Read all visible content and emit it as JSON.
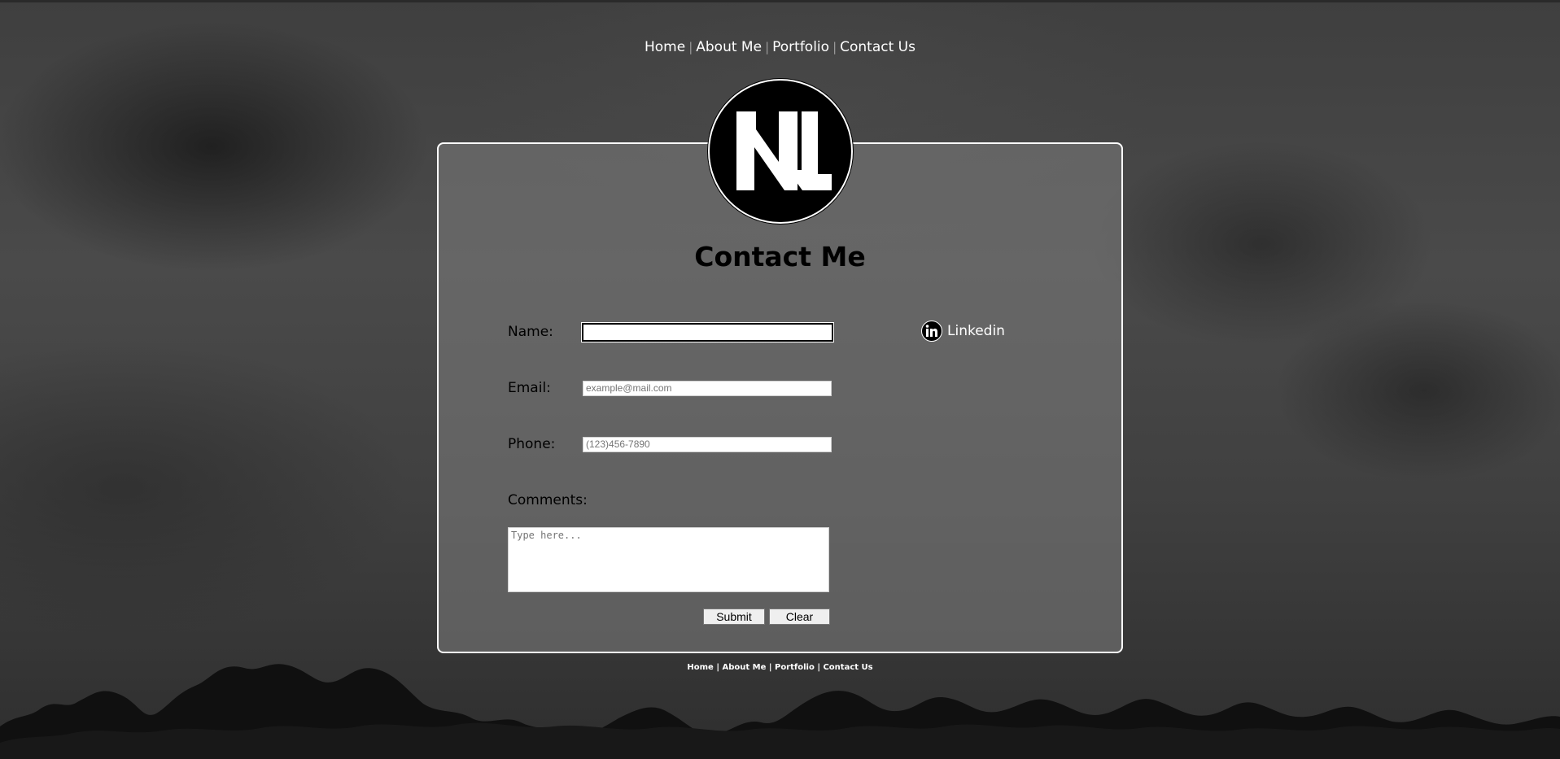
{
  "nav": {
    "items": [
      "Home",
      "About Me",
      "Portfolio",
      "Contact Us"
    ],
    "separator": "|"
  },
  "logo": {
    "text": "NL"
  },
  "page_title": "Contact Me",
  "form": {
    "name_label": "Name:",
    "name_value": "",
    "email_label": "Email:",
    "email_placeholder": "example@mail.com",
    "phone_label": "Phone:",
    "phone_placeholder": "(123)456-7890",
    "comments_label": "Comments:",
    "comments_placeholder": "Type here...",
    "submit_label": "Submit",
    "clear_label": "Clear"
  },
  "social": {
    "linkedin_label": "Linkedin",
    "icon": "linkedin-icon"
  },
  "footer": {
    "items": [
      "Home",
      "About Me",
      "Portfolio",
      "Contact Us"
    ],
    "separator": "|"
  },
  "colors": {
    "card_border": "#ffffff",
    "logo_bg": "#000000",
    "title": "#000000"
  }
}
